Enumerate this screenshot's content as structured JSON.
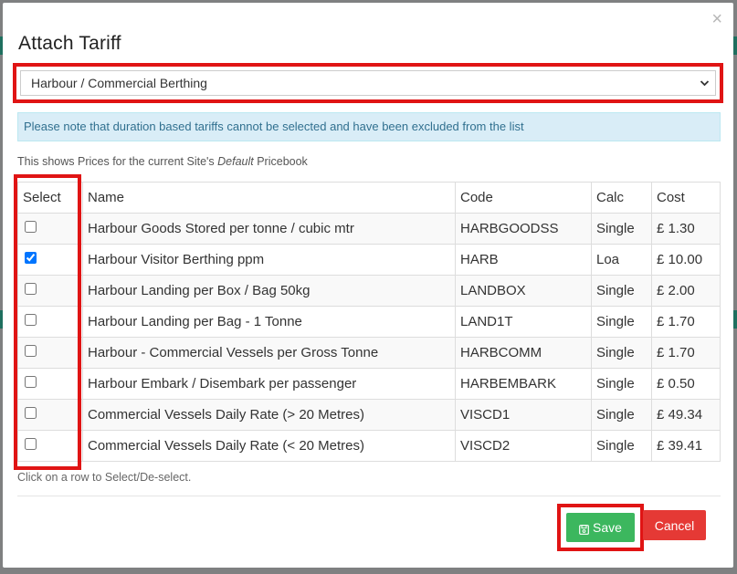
{
  "dialog": {
    "title": "Attach Tariff",
    "close_label": "×"
  },
  "tariff_select": {
    "selected": "Harbour / Commercial Berthing"
  },
  "info": {
    "message": "Please note that duration based tariffs cannot be selected and have been excluded from the list"
  },
  "note": {
    "prefix": "This shows Prices for the current Site's ",
    "emphasis": "Default",
    "suffix": " Pricebook"
  },
  "table": {
    "headers": {
      "select": "Select",
      "name": "Name",
      "code": "Code",
      "calc": "Calc",
      "cost": "Cost"
    },
    "rows": [
      {
        "checked": false,
        "name": "Harbour Goods Stored per tonne / cubic mtr",
        "code": "HARBGOODSS",
        "calc": "Single",
        "cost": "£ 1.30"
      },
      {
        "checked": true,
        "name": "Harbour Visitor Berthing ppm",
        "code": "HARB",
        "calc": "Loa",
        "cost": "£ 10.00"
      },
      {
        "checked": false,
        "name": "Harbour Landing per Box / Bag 50kg",
        "code": "LANDBOX",
        "calc": "Single",
        "cost": "£ 2.00"
      },
      {
        "checked": false,
        "name": "Harbour Landing per Bag - 1 Tonne",
        "code": "LAND1T",
        "calc": "Single",
        "cost": "£ 1.70"
      },
      {
        "checked": false,
        "name": "Harbour - Commercial Vessels per Gross Tonne",
        "code": "HARBCOMM",
        "calc": "Single",
        "cost": "£ 1.70"
      },
      {
        "checked": false,
        "name": "Harbour Embark / Disembark per passenger",
        "code": "HARBEMBARK",
        "calc": "Single",
        "cost": "£ 0.50"
      },
      {
        "checked": false,
        "name": "Commercial Vessels Daily Rate (> 20 Metres)",
        "code": "VISCD1",
        "calc": "Single",
        "cost": "£ 49.34"
      },
      {
        "checked": false,
        "name": "Commercial Vessels Daily Rate (< 20 Metres)",
        "code": "VISCD2",
        "calc": "Single",
        "cost": "£ 39.41"
      }
    ]
  },
  "hint": "Click on a row to Select/De-select.",
  "buttons": {
    "save": "Save",
    "cancel": "Cancel"
  },
  "colors": {
    "highlight": "#e01414",
    "save": "#3cb75e",
    "cancel": "#e53935",
    "info_bg": "#d9edf7"
  },
  "icons": {
    "save": "floppy-disk-icon",
    "close": "close-icon",
    "select": "chevron-down-icon"
  }
}
